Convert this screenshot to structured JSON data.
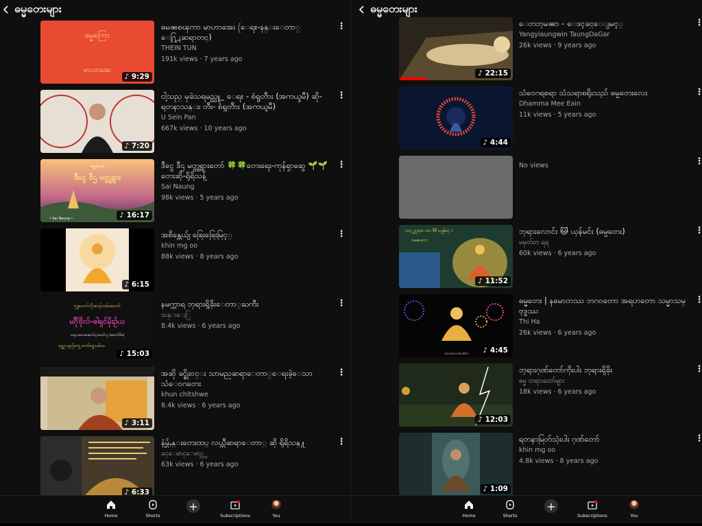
{
  "left": {
    "title": "ဓမ္မတေးများ",
    "videos": [
      {
        "title": "ဓမၼစၾကာ မာဟာအေး (ေရႊ-နန္းေတာ္ ေ႐ြ႕ဆရာတင္)",
        "channel": "THEIN TUN",
        "stats": "191k views · 7 years ago",
        "duration": "9:29",
        "thumb_text": [
          "ဓမ္မစကြာ",
          "မာဟာအေး"
        ]
      },
      {
        "title": "ငါ့သည္ မုခဲသရမည္သူ_ ေရႊ - စံရွတီား (အကယ္ဒမီ) ဆို- ရတနာသန္း၊ တီး- စံရွတီား (အကယ္ဒမီ)",
        "channel": "U Sein Pan",
        "stats": "667k views · 10 years ago",
        "duration": "7:20"
      },
      {
        "title": "ဒီငွေ ဒီဌ မတ္တ္တရားတော် 🍀🍀တေးရေး-ကုန်ရှာဆွေ 🌱🌱 တေးဆို-ရိုရိသန့်",
        "channel": "Sai Naung",
        "stats": "98k views · 5 years ago",
        "duration": "16:17",
        "thumb_text": [
          "ဓမ္မတေး",
          "ဒီငွေ ဒီဌ မတ္တ္တရား",
          "• Sai Naung •"
        ]
      },
      {
        "title": "အစိန္တေယ်ျ ၶြေးၶြေးမြင့္",
        "channel": "khin mg oo",
        "stats": "88k views · 8 years ago",
        "duration": "6:15"
      },
      {
        "title": "နမက္ကာရ ဘုရားရွိခိုးေတာ္ႀကီး",
        "channel": "သန္းေႏြ",
        "stats": "8.4k views · 6 years ago",
        "duration": "15:03",
        "thumb_text": [
          "ဗုဒ္ဓဟောင်ကိုးဆယ့်သစ်စေတော်",
          "မင်္ဂိုဗိုလ်-ဓါရှင်မိုးဉ်ယ",
          "သရသဆလဇးတော်ပုအလင်လူ (ဆောင်ဗိဇ)",
          "ရွှေဥယျာဉ်တွေ့ တော်ရွှေသစ်ဒေ"
        ]
      },
      {
        "title": "အဆို ခင္စိုး၀င္း သာမညဆရာေတာ္ေရးခဲ့ေသာ သံေ၀ဂတေး",
        "channel": "khun chitshwe",
        "stats": "8.4k views · 6 years ago",
        "duration": "3:11"
      },
      {
        "title": "နံ့မွ်ႇန္းတေးထပ္ လယ္တီဆရာေတာ္ ဆို ရိုရိသန္႔",
        "channel": "ခင္ေမာင္ေမာင္လွ",
        "stats": "63k views · 6 years ago",
        "duration": "6:33"
      }
    ]
  },
  "right": {
    "title": "ဓမ္မတေးများ",
    "videos": [
      {
        "title": "ေတဘုမၼာ - ေဒၚခင္ေျမင့္",
        "channel": "Yangyiaungwin TaungDaGar",
        "stats": "26k views · 9 years ago",
        "duration": "22:15"
      },
      {
        "title": "သံဝေဂရစရာ သံသရာစရိုးသည် ဓမ္မတေးလေး",
        "channel": "Dhamma Mee Eain",
        "stats": "11k views · 5 years ago",
        "duration": "4:44"
      },
      {
        "title": "",
        "channel": "No views",
        "stats": "",
        "duration": ""
      },
      {
        "title": "ဘုရားလောင်း 🐱 ယုန်မင်း (ဓမ္မတေး)",
        "channel": "မမှတ်တ ရရ",
        "stats": "60k views · 6 years ago",
        "duration": "11:52",
        "thumb_text": [
          "သင့္ရင္လယ္ေသာ 🐱 ယုန္ပါမင္း",
          "ဓမၼတေး"
        ]
      },
      {
        "title": "ဓမ္မတေး | နမောတဿ ဘဂဝတော အရဟတော သမ္မာသမ္ဗုဒ္ဓဿ",
        "channel": "Thi Ha",
        "stats": "26k views · 6 years ago",
        "duration": "4:45",
        "thumb_text": [
          "Gautama Buddha"
        ]
      },
      {
        "title": "ဘုရားဂုဏ်တော်ကိုးပါး ဘုရားရှိခိုး",
        "channel": "ဓမ္မ တရားတော်များ",
        "stats": "18k views · 6 years ago",
        "duration": "12:03"
      },
      {
        "title": "ရတနာမြတ်သုံးပါး ဂုဏ်တော်",
        "channel": "khin mg oo",
        "stats": "4.8k views · 8 years ago",
        "duration": "1:09"
      }
    ]
  },
  "nav": {
    "home": "Home",
    "shorts": "Shorts",
    "subscriptions": "Subscriptions",
    "you": "You"
  },
  "colors": {
    "background": "#0f0f0f",
    "text_primary": "#f1f1f1",
    "text_secondary": "#aaaaaa",
    "accent_red": "#ff0000"
  }
}
